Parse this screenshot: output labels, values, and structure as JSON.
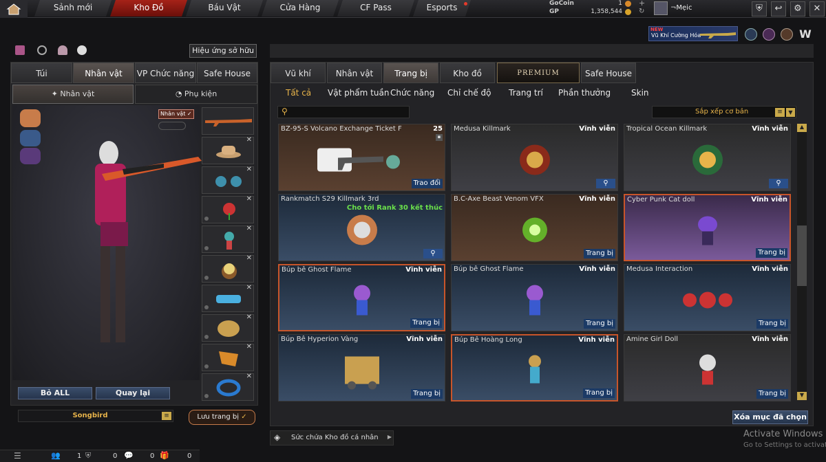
{
  "nav": {
    "tabs": [
      "Sảnh mới",
      "Kho Đồ",
      "Báu Vật",
      "Cửa Hàng",
      "CF Pass",
      "Esports"
    ],
    "active": 1
  },
  "currency": {
    "gocoin_label": "GoCoin",
    "gocoin_value": "1",
    "gp_label": "GP",
    "gp_value": "1,358,544",
    "username": "¬Mẹic"
  },
  "banner": {
    "new_label": "NEW",
    "text": "Vũ Khí Cường Hóa"
  },
  "left": {
    "effects_button": "Hiệu ứng sở hữu",
    "tabs": [
      "Túi",
      "Nhân vật",
      "VP Chức năng",
      "Safe House"
    ],
    "subtabs": [
      "Nhân vật",
      "Phụ kiện"
    ],
    "badge": "Nhân vật",
    "reset_all": "Bỏ ALL",
    "back": "Quay lại",
    "character_name": "Songbird",
    "save": "Lưu trang bị"
  },
  "main": {
    "tabs": [
      "Vũ khí",
      "Nhân vật",
      "Trang bị",
      "Kho đồ",
      "PREMIUM",
      "Safe House"
    ],
    "subtabs": [
      "Tất cả",
      "Vật phẩm tuần",
      "Chức năng",
      "Chỉ chế độ",
      "Trang trí",
      "Phần thưởng",
      "Skin"
    ],
    "search_placeholder": "",
    "sort": "Sắp xếp cơ bản",
    "delete_selected": "Xóa mục đã chọn",
    "storage": "Sức chứa Kho đồ cá nhân"
  },
  "items": [
    {
      "name": "BZ-95-S Volcano Exchange Ticket F",
      "duration": "25",
      "action": "Trao đổi",
      "style": "brown"
    },
    {
      "name": "Medusa Killmark",
      "duration": "Vĩnh viễn",
      "action": "",
      "style": "dark"
    },
    {
      "name": "Tropical Ocean Killmark",
      "duration": "Vĩnh viễn",
      "action": "",
      "style": "dark"
    },
    {
      "name": "Rankmatch S29 Killmark 3rd",
      "duration": "",
      "note": "Cho tới Rank 30 kết thúc",
      "action": "",
      "style": "blue"
    },
    {
      "name": "B.C-Axe Beast Venom VFX",
      "duration": "Vĩnh viễn",
      "action": "Trang bị",
      "style": "brown"
    },
    {
      "name": "Cyber Punk Cat doll",
      "duration": "Vĩnh viễn",
      "action": "Trang bị",
      "style": "purple"
    },
    {
      "name": "Búp bê Ghost Flame",
      "duration": "Vĩnh viễn",
      "action": "Trang bị",
      "style": "blue"
    },
    {
      "name": "Búp bê Ghost Flame",
      "duration": "Vĩnh viễn",
      "action": "Trang bị",
      "style": "blue"
    },
    {
      "name": "Medusa Interaction",
      "duration": "Vĩnh viễn",
      "action": "Trang bị",
      "style": "blue"
    },
    {
      "name": "Búp Bê Hyperion Vàng",
      "duration": "Vĩnh viễn",
      "action": "Trang bị",
      "style": "blue"
    },
    {
      "name": "Búp Bê Hoàng Long",
      "duration": "Vĩnh viễn",
      "action": "Trang bị",
      "style": "blue"
    },
    {
      "name": "Amine Girl Doll",
      "duration": "Vĩnh viễn",
      "action": "Trang bị",
      "style": "dark"
    }
  ],
  "statusbar": {
    "count1": "1",
    "count2": "0",
    "count3": "0",
    "count4": "0"
  },
  "watermark": {
    "line1": "Activate Windows",
    "line2": "Go to Settings to activate"
  }
}
